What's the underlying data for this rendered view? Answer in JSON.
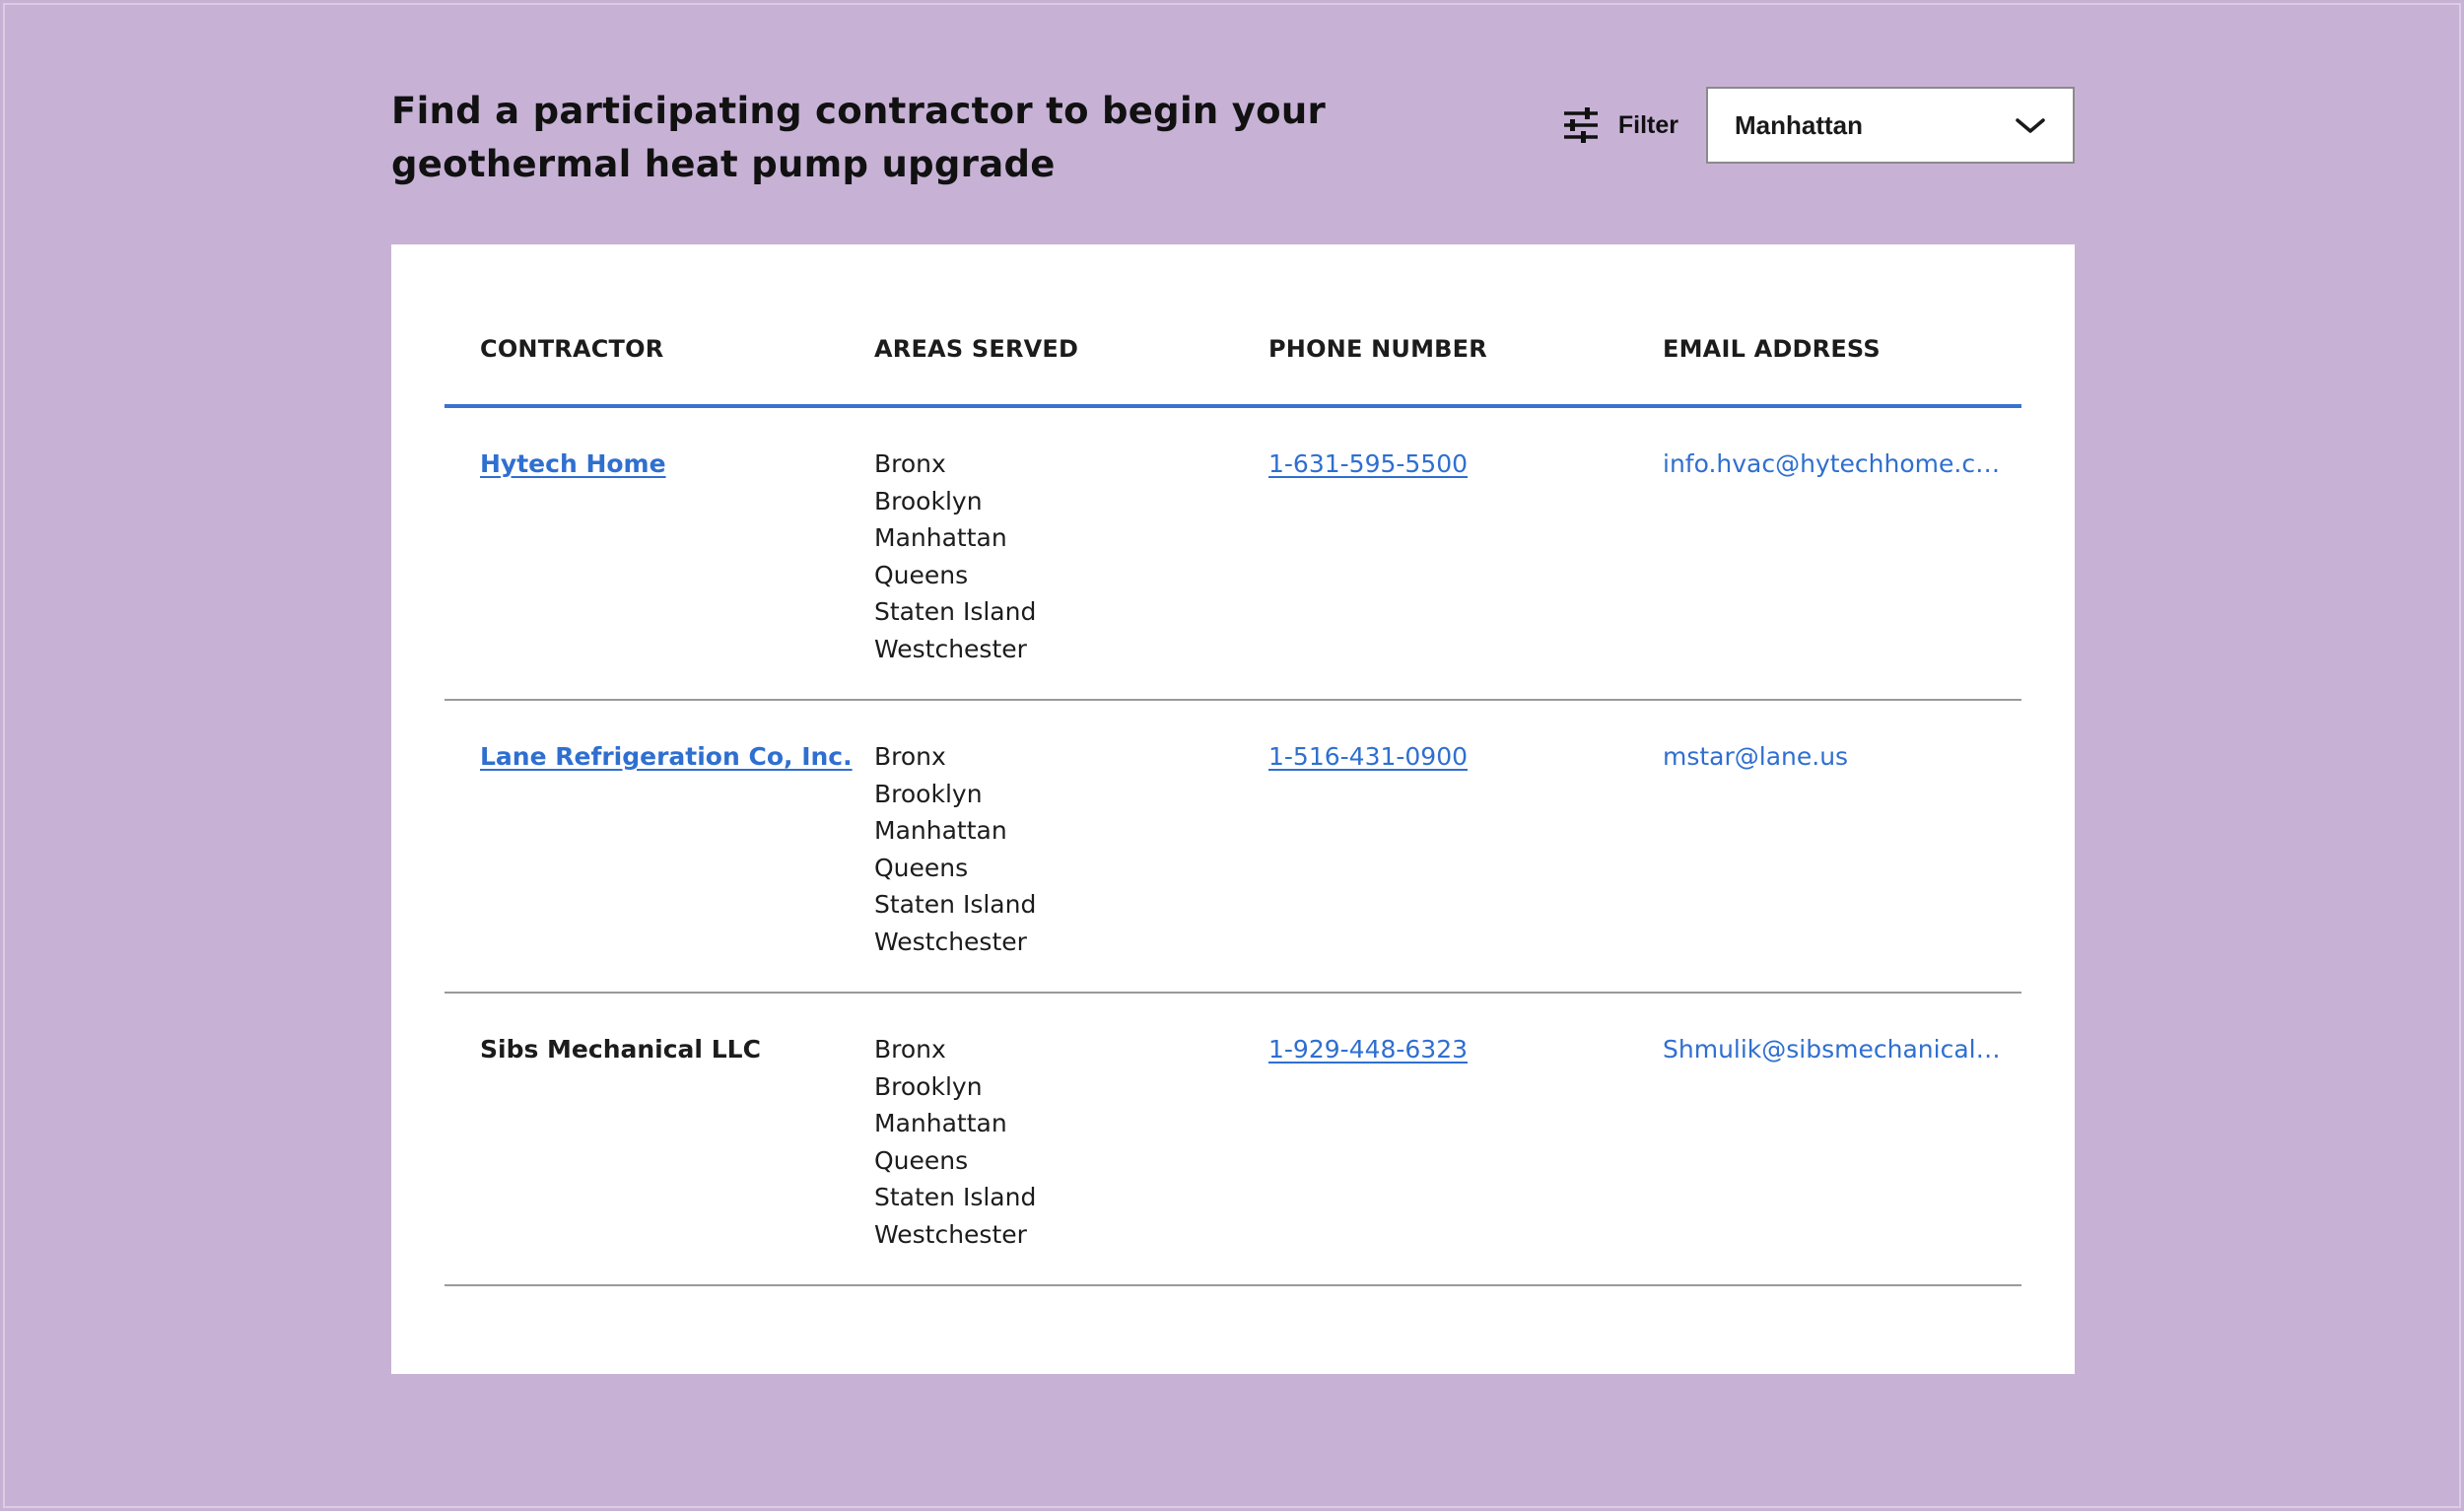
{
  "page": {
    "background_color": "#c7b2d6",
    "accent_color": "#3a72d0",
    "link_color": "#2f6fd0"
  },
  "header": {
    "title": "Find a participating contractor to begin your geothermal heat pump upgrade",
    "filter_label": "Filter",
    "filter_icon": "sliders-icon",
    "selected_borough": "Manhattan",
    "dropdown_icon": "chevron-down-icon"
  },
  "table": {
    "columns": [
      "CONTRACTOR",
      "AREAS SERVED",
      "PHONE NUMBER",
      "EMAIL ADDRESS"
    ],
    "rows": [
      {
        "contractor": "Hytech Home",
        "contractor_is_link": true,
        "areas": [
          "Bronx",
          "Brooklyn",
          "Manhattan",
          "Queens",
          "Staten Island",
          "Westchester"
        ],
        "phone": "1-631-595-5500",
        "email": "info.hvac@hytechhome.co..."
      },
      {
        "contractor": "Lane Refrigeration Co, Inc.",
        "contractor_is_link": true,
        "areas": [
          "Bronx",
          "Brooklyn",
          "Manhattan",
          "Queens",
          "Staten Island",
          "Westchester"
        ],
        "phone": "1-516-431-0900",
        "email": "mstar@lane.us"
      },
      {
        "contractor": "Sibs Mechanical LLC",
        "contractor_is_link": false,
        "areas": [
          "Bronx",
          "Brooklyn",
          "Manhattan",
          "Queens",
          "Staten Island",
          "Westchester"
        ],
        "phone": "1-929-448-6323",
        "email": "Shmulik@sibsmechanical...."
      }
    ]
  }
}
